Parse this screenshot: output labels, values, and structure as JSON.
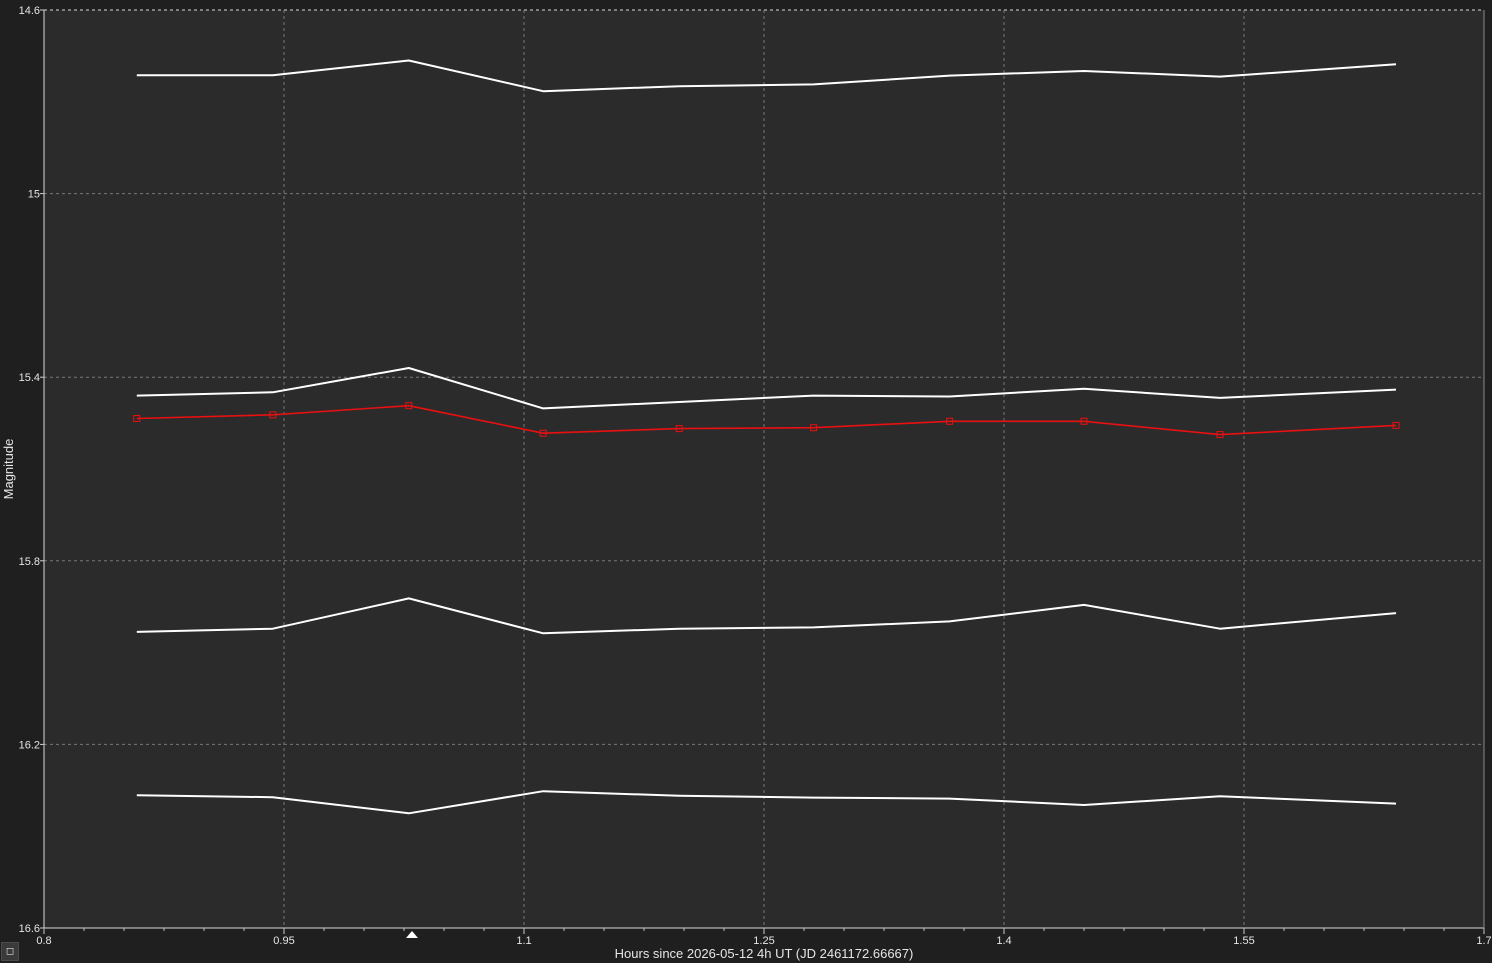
{
  "chart_data": {
    "type": "line",
    "xlabel": "Hours since 2026-05-12 4h UT (JD 2461172.66667)",
    "ylabel": "Magnitude",
    "xlim": [
      0.8,
      1.7
    ],
    "ylim": [
      14.6,
      16.6
    ],
    "y_inverted": true,
    "grid": true,
    "x_ticks": [
      "0.8",
      "0.95",
      "1.1",
      "1.25",
      "1.4",
      "1.55",
      "1.7"
    ],
    "y_ticks": [
      "14.6",
      "15",
      "15.4",
      "15.8",
      "16.2",
      "16.6"
    ],
    "colors": {
      "background": "#1f1f1f",
      "plot_area": "#2b2b2c",
      "grid": "#777777",
      "comparison": "#ffffff",
      "target": "#e81010"
    },
    "series": [
      {
        "role": "comparison",
        "x": [
          0.858,
          0.943,
          1.028,
          1.112,
          1.197,
          1.281,
          1.366,
          1.45,
          1.535,
          1.645
        ],
        "y": [
          14.742,
          14.742,
          14.71,
          14.777,
          14.766,
          14.762,
          14.743,
          14.733,
          14.745,
          14.718
        ]
      },
      {
        "role": "comparison",
        "x": [
          0.858,
          0.943,
          1.028,
          1.112,
          1.197,
          1.281,
          1.366,
          1.45,
          1.535,
          1.645
        ],
        "y": [
          15.44,
          15.433,
          15.38,
          15.468,
          15.454,
          15.44,
          15.442,
          15.425,
          15.445,
          15.427
        ]
      },
      {
        "role": "target",
        "x": [
          0.858,
          0.943,
          1.028,
          1.112,
          1.197,
          1.281,
          1.366,
          1.45,
          1.535,
          1.645
        ],
        "y": [
          15.49,
          15.482,
          15.462,
          15.522,
          15.512,
          15.51,
          15.496,
          15.496,
          15.525,
          15.505
        ]
      },
      {
        "role": "comparison",
        "x": [
          0.858,
          0.943,
          1.028,
          1.112,
          1.197,
          1.281,
          1.366,
          1.45,
          1.535,
          1.645
        ],
        "y": [
          15.955,
          15.948,
          15.882,
          15.958,
          15.948,
          15.945,
          15.932,
          15.896,
          15.948,
          15.914
        ]
      },
      {
        "role": "comparison",
        "x": [
          0.858,
          0.943,
          1.028,
          1.112,
          1.197,
          1.281,
          1.366,
          1.45,
          1.535,
          1.645
        ],
        "y": [
          16.311,
          16.315,
          16.35,
          16.302,
          16.312,
          16.316,
          16.318,
          16.332,
          16.313,
          16.329
        ]
      }
    ],
    "x_marker": 1.03
  },
  "ui": {
    "corner_button_glyph": "◻"
  }
}
